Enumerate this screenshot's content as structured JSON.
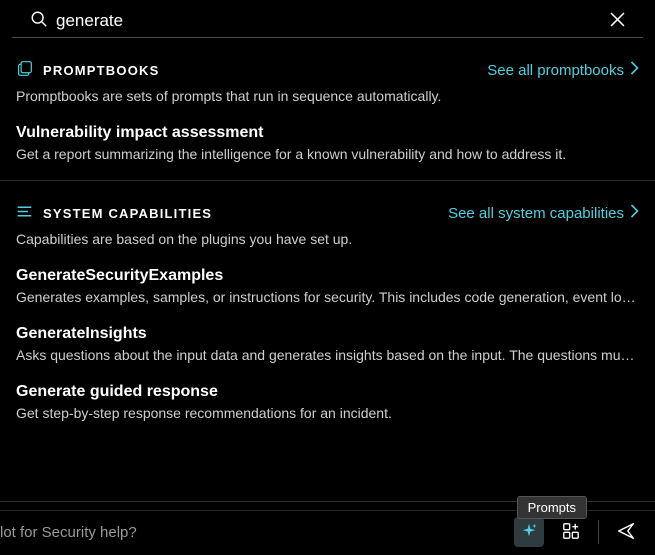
{
  "search": {
    "value": "generate"
  },
  "promptbooks": {
    "title": "PROMPTBOOKS",
    "see_all": "See all promptbooks",
    "description": "Promptbooks are sets of prompts that run in sequence automatically.",
    "items": [
      {
        "title": "Vulnerability impact assessment",
        "description": "Get a report summarizing the intelligence for a known vulnerability and how to address it."
      }
    ]
  },
  "system_capabilities": {
    "title": "SYSTEM CAPABILITIES",
    "see_all": "See all system capabilities",
    "description": "Capabilities are based on the plugins you have set up.",
    "items": [
      {
        "title": "GenerateSecurityExamples",
        "description": "Generates examples, samples, or instructions for security. This includes code generation, event logs, or r…"
      },
      {
        "title": "GenerateInsights",
        "description": "Asks questions about the input data and generates insights based on the input. The questions must be …"
      },
      {
        "title": "Generate guided response",
        "description": "Get step-by-step response recommendations for an incident."
      }
    ]
  },
  "bottom": {
    "placeholder": "lot for Security help?",
    "tooltip": "Prompts"
  },
  "colors": {
    "accent": "#4dd0e1",
    "background": "#000000"
  }
}
